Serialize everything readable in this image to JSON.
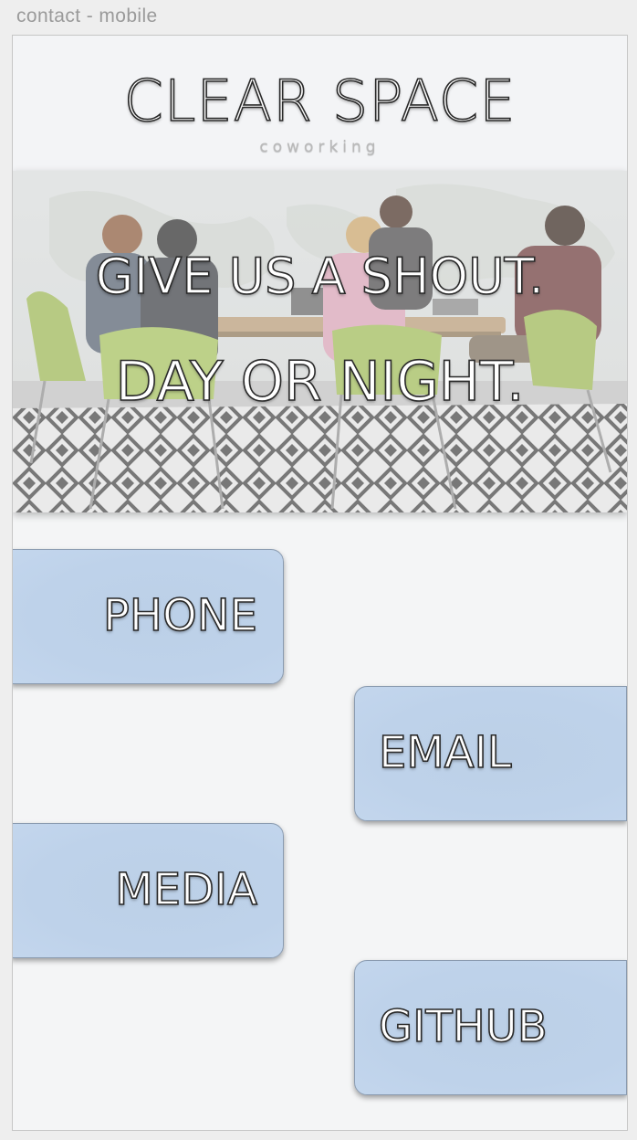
{
  "frame": {
    "label": "contact - mobile"
  },
  "header": {
    "brand_name": "CLEAR SPACE",
    "brand_sub": "coworking"
  },
  "hero": {
    "line1": "GIVE US A SHOUT.",
    "line2": "DAY OR NIGHT."
  },
  "contacts": [
    {
      "label": "PHONE"
    },
    {
      "label": "EMAIL"
    },
    {
      "label": "MEDIA"
    },
    {
      "label": "GITHUB"
    }
  ],
  "colors": {
    "button_fill": "#bed2ea",
    "button_border": "#8a9bb0",
    "background": "#f4f5f6",
    "text_outline": "#2a2a2a"
  }
}
